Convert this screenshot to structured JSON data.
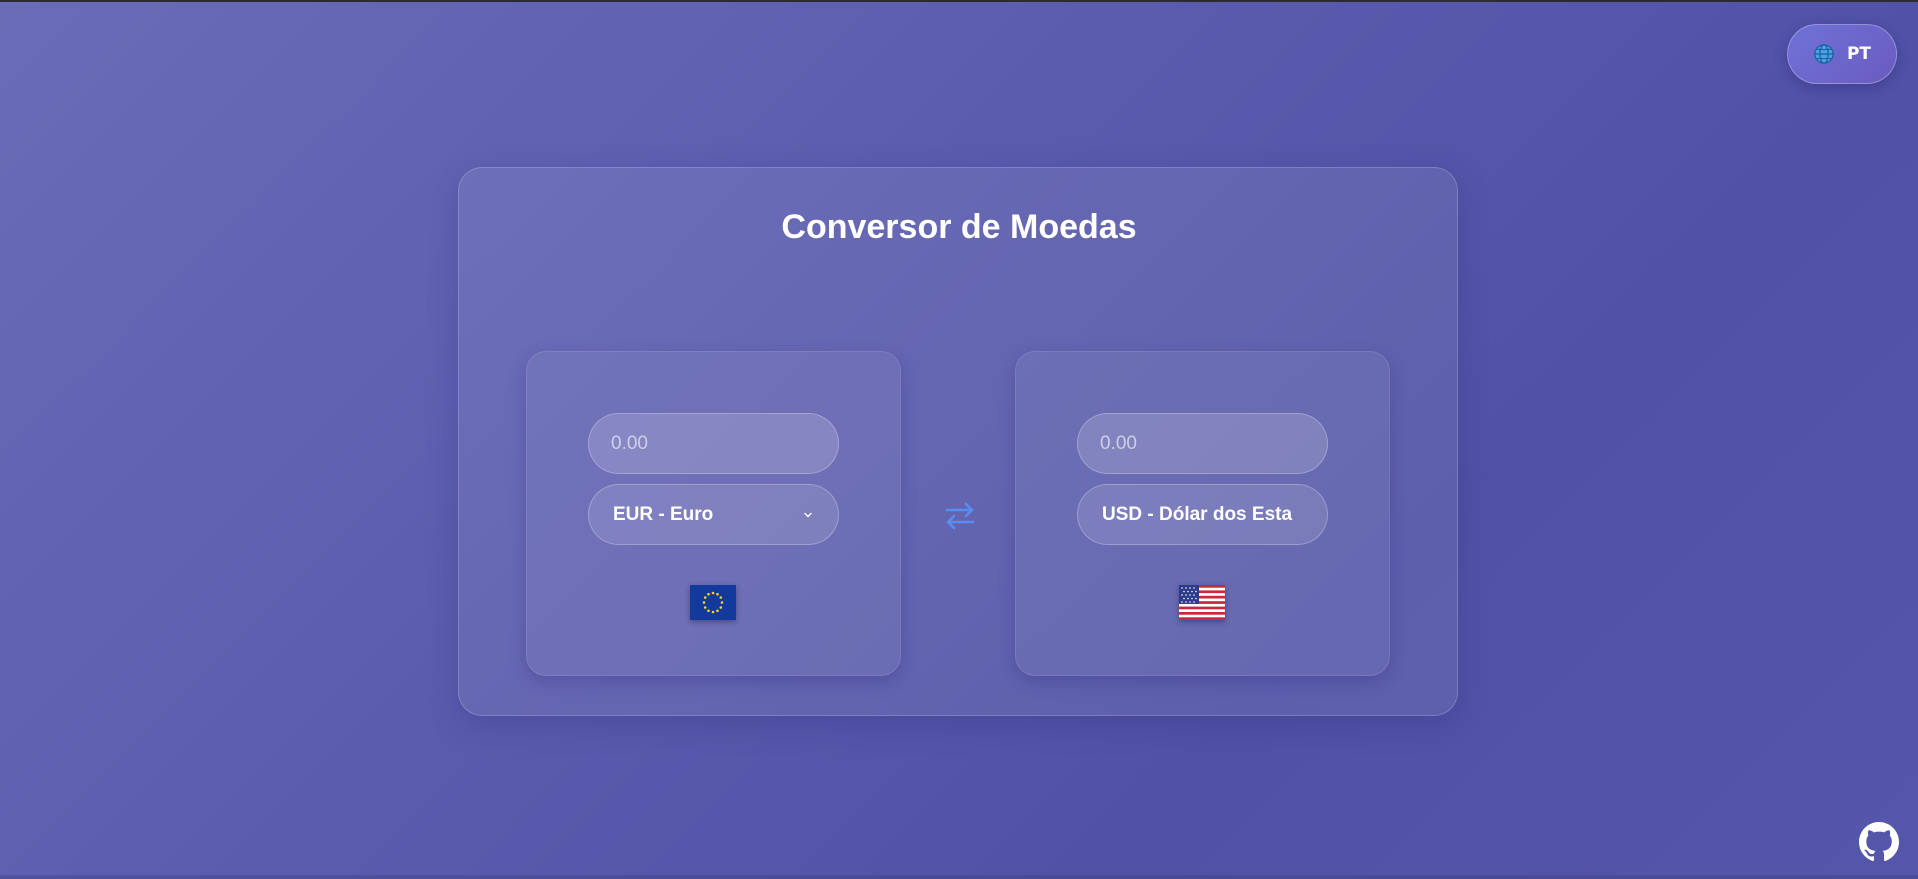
{
  "language": {
    "label": "PT",
    "icon": "globe-icon"
  },
  "converter": {
    "title": "Conversor de Moedas",
    "from": {
      "amount_placeholder": "0.00",
      "currency": "EUR - Euro",
      "flag": "eu-flag-icon"
    },
    "to": {
      "amount_placeholder": "0.00",
      "currency": "USD - Dólar dos Esta",
      "flag": "us-flag-icon"
    },
    "swap_icon": "swap-arrows-icon"
  },
  "footer": {
    "github_icon": "github-icon"
  },
  "colors": {
    "background": "#5a5cae",
    "accent": "#5b8cf0",
    "text": "#ffffff"
  }
}
